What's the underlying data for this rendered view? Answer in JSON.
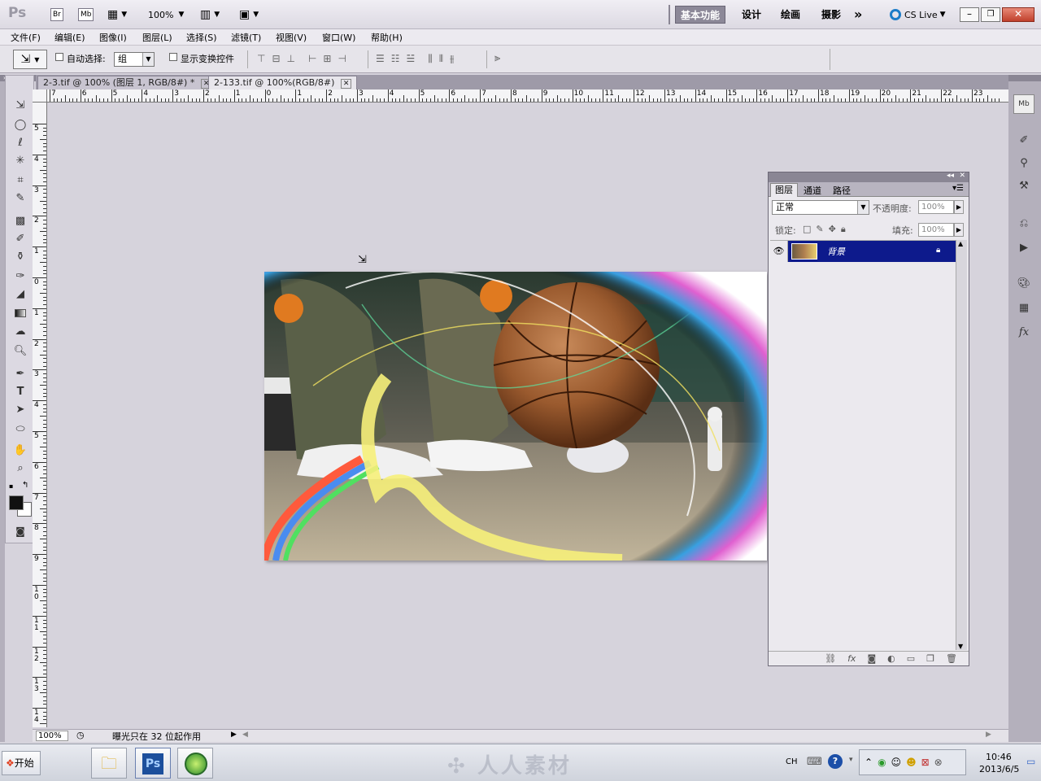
{
  "appbar": {
    "logo": "Ps",
    "br_label": "Br",
    "mb_label": "Mb",
    "zoom": "100%",
    "workspaces": [
      "基本功能",
      "设计",
      "绘画",
      "摄影"
    ],
    "more": "»",
    "cslive": "CS Live"
  },
  "menu": [
    "文件(F)",
    "编辑(E)",
    "图像(I)",
    "图层(L)",
    "选择(S)",
    "滤镜(T)",
    "视图(V)",
    "窗口(W)",
    "帮助(H)"
  ],
  "options": {
    "autoselect_label": "自动选择:",
    "autoselect_value": "组",
    "transform_label": "显示变换控件"
  },
  "tabs": [
    {
      "label": "2-3.tif @ 100% (图层 1, RGB/8#) *"
    },
    {
      "label": "2-133.tif @ 100%(RGB/8#)"
    }
  ],
  "ruler_top": [
    "7",
    "6",
    "5",
    "4",
    "3",
    "2",
    "1",
    "0",
    "1",
    "2",
    "3",
    "4",
    "5",
    "6",
    "7",
    "8",
    "9",
    "10",
    "11",
    "12",
    "13",
    "14",
    "15",
    "16",
    "17",
    "18",
    "19",
    "20",
    "21",
    "22",
    "23"
  ],
  "ruler_left": [
    "5",
    "4",
    "3",
    "2",
    "1",
    "0",
    "1",
    "2",
    "3",
    "4",
    "5",
    "6",
    "7",
    "8",
    "9",
    "10",
    "11",
    "12",
    "13",
    "14"
  ],
  "status": {
    "zoom": "100%",
    "info": "曝光只在 32 位起作用"
  },
  "layers_panel": {
    "tabs": [
      "图层",
      "通道",
      "路径"
    ],
    "blend_mode": "正常",
    "opacity_label": "不透明度:",
    "opacity_value": "100%",
    "lock_label": "锁定:",
    "fill_label": "填充:",
    "fill_value": "100%",
    "layer_name": "背景"
  },
  "taskbar": {
    "start": "开始",
    "ps": "Ps",
    "watermark": "人人素材",
    "lang": "CH",
    "time": "10:46",
    "date": "2013/6/5"
  },
  "colors": {
    "accent_selection": "#0d1a8c",
    "ps_blue": "#1c4f9c",
    "dark_bg": "#d6d3dc"
  }
}
